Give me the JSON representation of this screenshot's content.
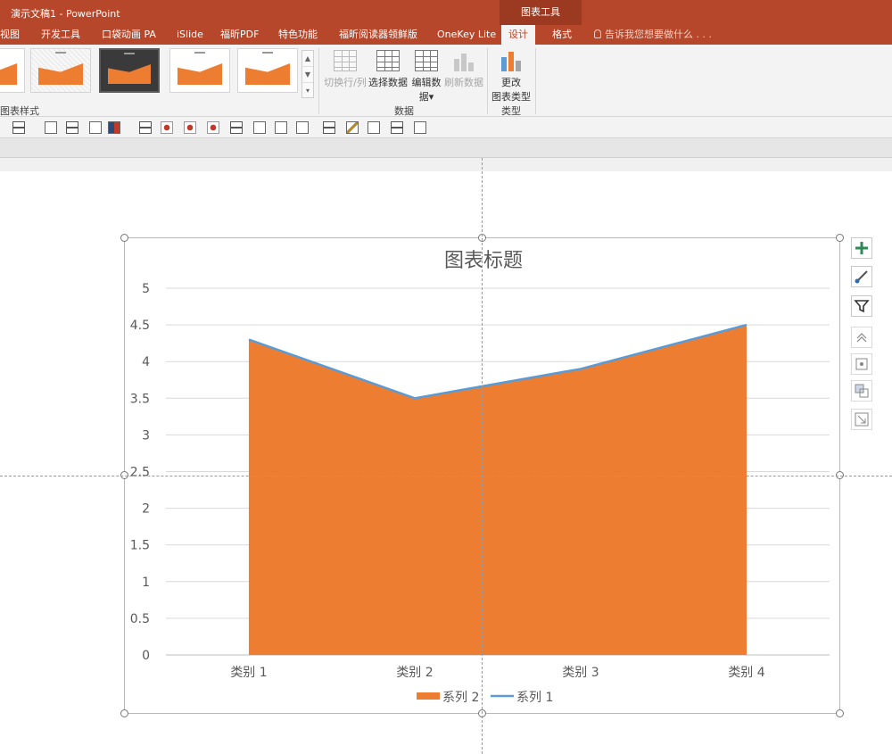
{
  "window": {
    "title": "演示文稿1 - PowerPoint",
    "context_tab_header": "图表工具"
  },
  "tabs": [
    {
      "label": "视图",
      "active": false
    },
    {
      "label": "开发工具",
      "active": false
    },
    {
      "label": "口袋动画 PA",
      "active": false
    },
    {
      "label": "iSlide",
      "active": false
    },
    {
      "label": "福昕PDF",
      "active": false
    },
    {
      "label": "特色功能",
      "active": false
    },
    {
      "label": "福昕阅读器领鲜版",
      "active": false
    },
    {
      "label": "OneKey Lite",
      "active": false
    },
    {
      "label": "设计",
      "active": true
    },
    {
      "label": "格式",
      "active": false
    }
  ],
  "tell_me": "告诉我您想要做什么 . . .",
  "ribbon": {
    "chart_styles_label": "图表样式",
    "data_group_label": "数据",
    "type_group_label": "类型",
    "buttons": {
      "switch_row_col": "切换行/列",
      "select_data": "选择数据",
      "edit_data_line1": "编辑数",
      "edit_data_line2": "据",
      "refresh_data": "刷新数据",
      "change_type_line1": "更改",
      "change_type_line2": "图表类型"
    }
  },
  "colors": {
    "accent": "#b7472a",
    "series2": "#ed7d31",
    "series1": "#5b9bd5"
  },
  "chart_data": {
    "type": "area",
    "title": "图表标题",
    "categories": [
      "类别 1",
      "类别 2",
      "类别 3",
      "类别 4"
    ],
    "series": [
      {
        "name": "系列 2",
        "type": "area",
        "values": [
          4.3,
          3.5,
          3.9,
          4.5
        ]
      },
      {
        "name": "系列 1",
        "type": "line",
        "values": [
          4.3,
          3.5,
          3.9,
          4.5
        ]
      }
    ],
    "yticks": [
      "0",
      "0.5",
      "1",
      "1.5",
      "2",
      "2.5",
      "3",
      "3.5",
      "4",
      "4.5",
      "5"
    ],
    "ylim": [
      0,
      5
    ],
    "grid": true,
    "legend": "bottom"
  }
}
